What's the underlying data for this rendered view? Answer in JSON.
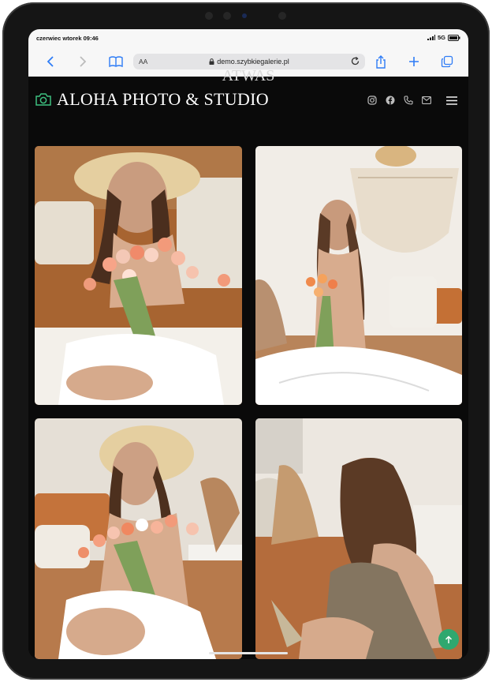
{
  "status_bar": {
    "time": "czerwiec wtorek 09:46",
    "network": "5G"
  },
  "browser": {
    "reader_label": "AA",
    "url": "demo.szybkiegalerie.pl",
    "icons": [
      "back-icon",
      "forward-icon",
      "bookmarks-icon",
      "lock-icon",
      "reload-icon",
      "share-icon",
      "new-tab-icon",
      "tabs-icon"
    ]
  },
  "site": {
    "cut_heading": "ATWAS",
    "brand": "ALOHA PHOTO & STUDIO",
    "social_icons": [
      "instagram-icon",
      "facebook-icon",
      "phone-icon",
      "mail-icon",
      "menu-icon"
    ],
    "gallery": [
      {
        "name": "photo-woman-hat-tulips-1"
      },
      {
        "name": "photo-woman-macrame-tulips"
      },
      {
        "name": "photo-woman-hat-tulips-2"
      },
      {
        "name": "photo-woman-sweater-smiling"
      }
    ]
  },
  "colors": {
    "accent": "#2fa86f",
    "page_bg": "#0a0a0a",
    "brand_text": "#ffffff"
  }
}
